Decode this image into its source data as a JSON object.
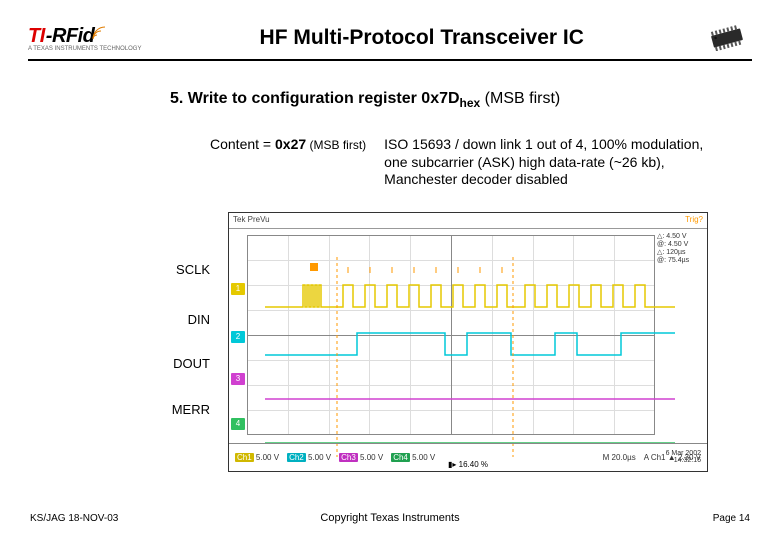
{
  "logo": {
    "ti": "TI",
    "rfid": "-RFid",
    "tagline": "A TEXAS INSTRUMENTS TECHNOLOGY"
  },
  "title": "HF Multi-Protocol Transceiver IC",
  "section": {
    "num": "5. ",
    "text": "Write to configuration register 0x7D",
    "sub": "hex",
    "tail": " (MSB first)"
  },
  "content": {
    "label_head": "Content = ",
    "label_val": "0x27",
    "label_tail": " (MSB first)",
    "desc": "ISO 15693 / down link 1 out of 4, 100% modulation, one subcarrier (ASK) high data-rate (~26 kb), Manchester decoder disabled"
  },
  "signals": {
    "sclk": "SCLK",
    "din": "DIN",
    "dout": "DOUT",
    "merr": "MERR"
  },
  "scope": {
    "top_left": "Tek PreVu",
    "top_right": "Trig?",
    "cursor": {
      "l1": "△: 4.50 V",
      "l2": "@: 4.50 V",
      "l3": "△: 120µs",
      "l4": "@: 75.4µs"
    },
    "bot": {
      "ch1": "Ch1",
      "ch1v": "5.00 V",
      "ch2": "Ch2",
      "ch2v": "5.00 V",
      "ch3": "Ch3",
      "ch3v": "5.00 V",
      "ch4": "Ch4",
      "ch4v": "5.00 V",
      "m": "M 20.0µs",
      "a": "A Ch1 ▲ 2.30 V",
      "date": "6 Mar 2002",
      "time": "14:32:16",
      "pos": "▮▸ 16.40 %"
    }
  },
  "footer": {
    "left": "KS/JAG 18-NOV-03",
    "center": "Copyright Texas Instruments",
    "right": "Page 14"
  }
}
